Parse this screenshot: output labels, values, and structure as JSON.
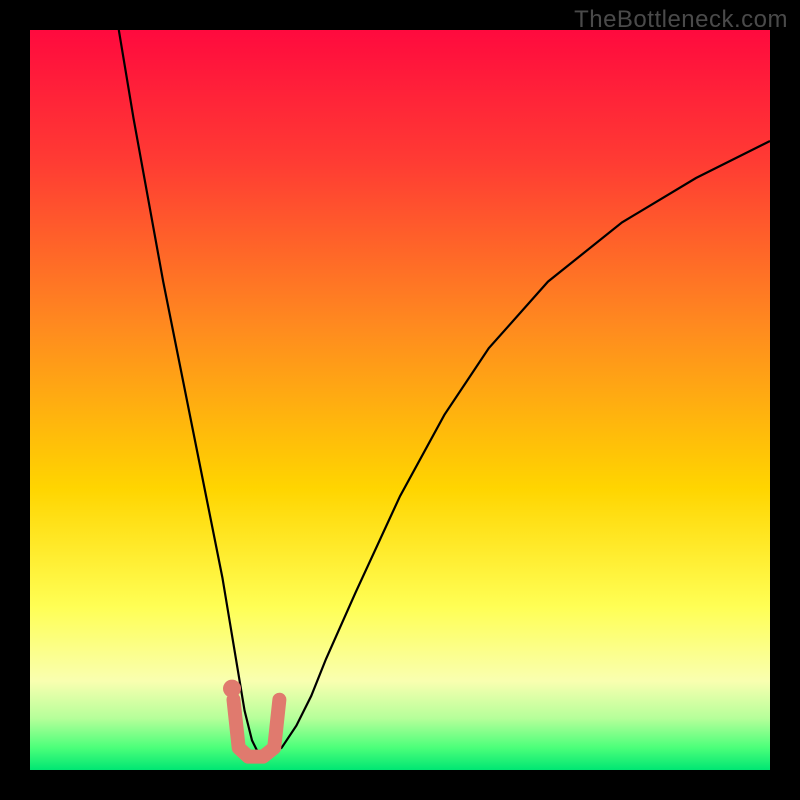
{
  "watermark": "TheBottleneck.com",
  "chart_data": {
    "type": "line",
    "title": "",
    "xlabel": "",
    "ylabel": "",
    "xlim": [
      0,
      100
    ],
    "ylim": [
      0,
      100
    ],
    "background_gradient": {
      "stops": [
        {
          "offset": 0.0,
          "color": "#ff0a3e"
        },
        {
          "offset": 0.18,
          "color": "#ff3c33"
        },
        {
          "offset": 0.4,
          "color": "#ff8a1f"
        },
        {
          "offset": 0.62,
          "color": "#ffd500"
        },
        {
          "offset": 0.78,
          "color": "#ffff55"
        },
        {
          "offset": 0.88,
          "color": "#f9ffb0"
        },
        {
          "offset": 0.93,
          "color": "#b6ff9a"
        },
        {
          "offset": 0.97,
          "color": "#4bff7a"
        },
        {
          "offset": 1.0,
          "color": "#00e673"
        }
      ]
    },
    "series": [
      {
        "name": "curve",
        "color": "#000000",
        "width": 2.2,
        "x": [
          12,
          14,
          16,
          18,
          20,
          22,
          24,
          26,
          27,
          28,
          29,
          30,
          31,
          32,
          34,
          36,
          38,
          40,
          44,
          50,
          56,
          62,
          70,
          80,
          90,
          100
        ],
        "y": [
          100,
          88,
          77,
          66,
          56,
          46,
          36,
          26,
          20,
          14,
          8,
          4,
          2,
          2,
          3,
          6,
          10,
          15,
          24,
          37,
          48,
          57,
          66,
          74,
          80,
          85
        ]
      },
      {
        "name": "bracket",
        "color": "#e07a6e",
        "width": 14,
        "linecap": "round",
        "linejoin": "round",
        "x": [
          27.5,
          28.2,
          29.5,
          31.5,
          33.0,
          33.7
        ],
        "y": [
          9.5,
          3.0,
          1.8,
          1.8,
          3.0,
          9.5
        ]
      }
    ],
    "points": [
      {
        "name": "dot",
        "x": 27.3,
        "y": 11.0,
        "r": 9,
        "color": "#e07a6e"
      }
    ]
  }
}
